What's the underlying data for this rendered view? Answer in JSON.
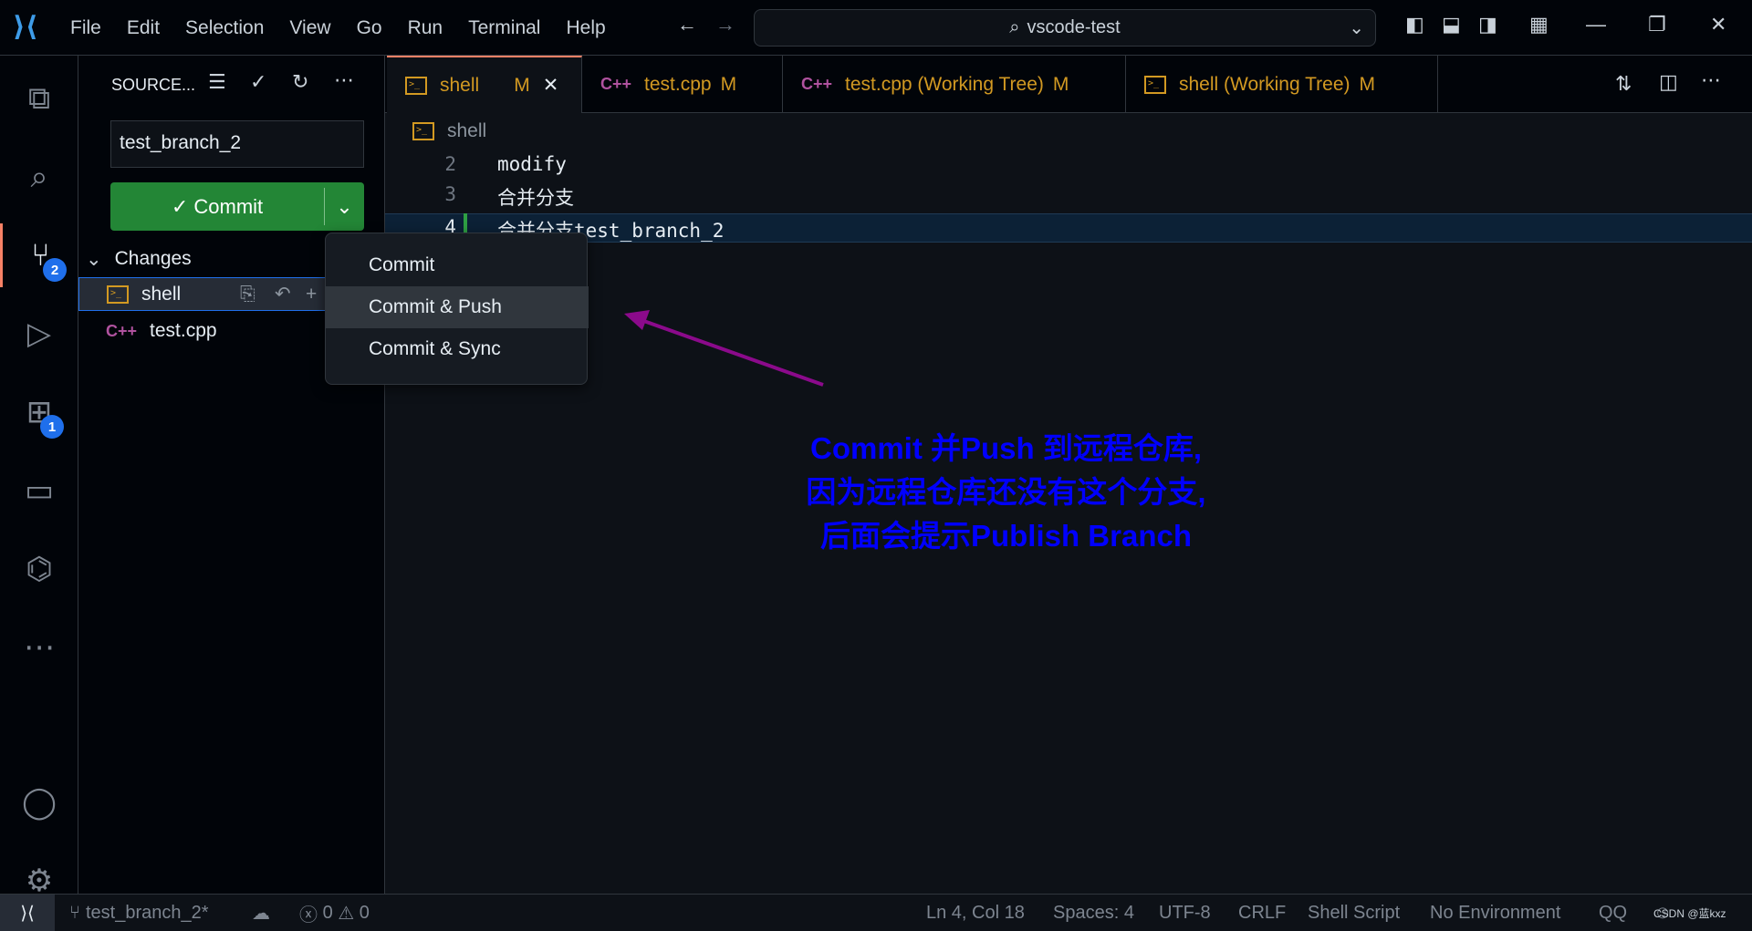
{
  "menu": [
    "File",
    "Edit",
    "Selection",
    "View",
    "Go",
    "Run",
    "Terminal",
    "Help"
  ],
  "search": "vscode-test",
  "activity": {
    "scm_badge": "2",
    "extensions_badge": "1"
  },
  "sidebar": {
    "title": "SOURCE...",
    "message": "test_branch_2",
    "commit_label": "✓ Commit",
    "changes_label": "Changes",
    "files": [
      {
        "name": "shell",
        "icon": "terminal-file-icon"
      },
      {
        "name": "test.cpp",
        "icon": "cpp-file-icon"
      }
    ]
  },
  "commit_menu": [
    "Commit",
    "Commit & Push",
    "Commit & Sync"
  ],
  "tabs": [
    {
      "label": "shell",
      "status": "M"
    },
    {
      "label": "test.cpp",
      "status": "M"
    },
    {
      "label": "test.cpp (Working Tree)",
      "status": "M"
    },
    {
      "label": "shell (Working Tree)",
      "status": "M"
    }
  ],
  "breadcrumb": "shell",
  "lines": [
    {
      "n": "2",
      "text": "modify"
    },
    {
      "n": "3",
      "text": "合并分支"
    },
    {
      "n": "4",
      "text": "合并分支test_branch_2"
    }
  ],
  "annotation": [
    "Commit 并Push 到远程仓库,",
    "因为远程仓库还没有这个分支,",
    "后面会提示Publish Branch"
  ],
  "status": {
    "branch": "test_branch_2*",
    "errors": "0",
    "warnings": "0",
    "position": "Ln 4, Col 18",
    "spaces": "Spaces: 4",
    "encoding": "UTF-8",
    "eol": "CRLF",
    "language": "Shell Script",
    "env": "No Environment",
    "qq": "QQ",
    "watermark": "CSDN @蓝kxz"
  },
  "colors": {
    "accent": "#f78166",
    "commit_button": "#238636",
    "annotation": "#0000ff",
    "arrow": "#8b0a8b"
  }
}
